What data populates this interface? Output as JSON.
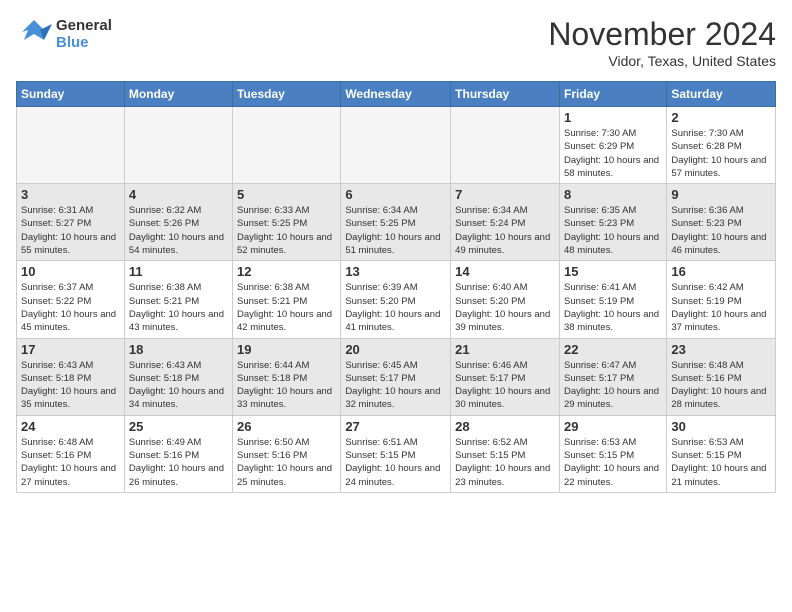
{
  "logo": {
    "text_general": "General",
    "text_blue": "Blue"
  },
  "title": "November 2024",
  "location": "Vidor, Texas, United States",
  "weekdays": [
    "Sunday",
    "Monday",
    "Tuesday",
    "Wednesday",
    "Thursday",
    "Friday",
    "Saturday"
  ],
  "weeks": [
    [
      {
        "day": "",
        "empty": true
      },
      {
        "day": "",
        "empty": true
      },
      {
        "day": "",
        "empty": true
      },
      {
        "day": "",
        "empty": true
      },
      {
        "day": "",
        "empty": true
      },
      {
        "day": "1",
        "sunrise": "Sunrise: 7:30 AM",
        "sunset": "Sunset: 6:29 PM",
        "daylight": "Daylight: 10 hours and 58 minutes."
      },
      {
        "day": "2",
        "sunrise": "Sunrise: 7:30 AM",
        "sunset": "Sunset: 6:28 PM",
        "daylight": "Daylight: 10 hours and 57 minutes."
      }
    ],
    [
      {
        "day": "3",
        "sunrise": "Sunrise: 6:31 AM",
        "sunset": "Sunset: 5:27 PM",
        "daylight": "Daylight: 10 hours and 55 minutes."
      },
      {
        "day": "4",
        "sunrise": "Sunrise: 6:32 AM",
        "sunset": "Sunset: 5:26 PM",
        "daylight": "Daylight: 10 hours and 54 minutes."
      },
      {
        "day": "5",
        "sunrise": "Sunrise: 6:33 AM",
        "sunset": "Sunset: 5:25 PM",
        "daylight": "Daylight: 10 hours and 52 minutes."
      },
      {
        "day": "6",
        "sunrise": "Sunrise: 6:34 AM",
        "sunset": "Sunset: 5:25 PM",
        "daylight": "Daylight: 10 hours and 51 minutes."
      },
      {
        "day": "7",
        "sunrise": "Sunrise: 6:34 AM",
        "sunset": "Sunset: 5:24 PM",
        "daylight": "Daylight: 10 hours and 49 minutes."
      },
      {
        "day": "8",
        "sunrise": "Sunrise: 6:35 AM",
        "sunset": "Sunset: 5:23 PM",
        "daylight": "Daylight: 10 hours and 48 minutes."
      },
      {
        "day": "9",
        "sunrise": "Sunrise: 6:36 AM",
        "sunset": "Sunset: 5:23 PM",
        "daylight": "Daylight: 10 hours and 46 minutes."
      }
    ],
    [
      {
        "day": "10",
        "sunrise": "Sunrise: 6:37 AM",
        "sunset": "Sunset: 5:22 PM",
        "daylight": "Daylight: 10 hours and 45 minutes."
      },
      {
        "day": "11",
        "sunrise": "Sunrise: 6:38 AM",
        "sunset": "Sunset: 5:21 PM",
        "daylight": "Daylight: 10 hours and 43 minutes."
      },
      {
        "day": "12",
        "sunrise": "Sunrise: 6:38 AM",
        "sunset": "Sunset: 5:21 PM",
        "daylight": "Daylight: 10 hours and 42 minutes."
      },
      {
        "day": "13",
        "sunrise": "Sunrise: 6:39 AM",
        "sunset": "Sunset: 5:20 PM",
        "daylight": "Daylight: 10 hours and 41 minutes."
      },
      {
        "day": "14",
        "sunrise": "Sunrise: 6:40 AM",
        "sunset": "Sunset: 5:20 PM",
        "daylight": "Daylight: 10 hours and 39 minutes."
      },
      {
        "day": "15",
        "sunrise": "Sunrise: 6:41 AM",
        "sunset": "Sunset: 5:19 PM",
        "daylight": "Daylight: 10 hours and 38 minutes."
      },
      {
        "day": "16",
        "sunrise": "Sunrise: 6:42 AM",
        "sunset": "Sunset: 5:19 PM",
        "daylight": "Daylight: 10 hours and 37 minutes."
      }
    ],
    [
      {
        "day": "17",
        "sunrise": "Sunrise: 6:43 AM",
        "sunset": "Sunset: 5:18 PM",
        "daylight": "Daylight: 10 hours and 35 minutes."
      },
      {
        "day": "18",
        "sunrise": "Sunrise: 6:43 AM",
        "sunset": "Sunset: 5:18 PM",
        "daylight": "Daylight: 10 hours and 34 minutes."
      },
      {
        "day": "19",
        "sunrise": "Sunrise: 6:44 AM",
        "sunset": "Sunset: 5:18 PM",
        "daylight": "Daylight: 10 hours and 33 minutes."
      },
      {
        "day": "20",
        "sunrise": "Sunrise: 6:45 AM",
        "sunset": "Sunset: 5:17 PM",
        "daylight": "Daylight: 10 hours and 32 minutes."
      },
      {
        "day": "21",
        "sunrise": "Sunrise: 6:46 AM",
        "sunset": "Sunset: 5:17 PM",
        "daylight": "Daylight: 10 hours and 30 minutes."
      },
      {
        "day": "22",
        "sunrise": "Sunrise: 6:47 AM",
        "sunset": "Sunset: 5:17 PM",
        "daylight": "Daylight: 10 hours and 29 minutes."
      },
      {
        "day": "23",
        "sunrise": "Sunrise: 6:48 AM",
        "sunset": "Sunset: 5:16 PM",
        "daylight": "Daylight: 10 hours and 28 minutes."
      }
    ],
    [
      {
        "day": "24",
        "sunrise": "Sunrise: 6:48 AM",
        "sunset": "Sunset: 5:16 PM",
        "daylight": "Daylight: 10 hours and 27 minutes."
      },
      {
        "day": "25",
        "sunrise": "Sunrise: 6:49 AM",
        "sunset": "Sunset: 5:16 PM",
        "daylight": "Daylight: 10 hours and 26 minutes."
      },
      {
        "day": "26",
        "sunrise": "Sunrise: 6:50 AM",
        "sunset": "Sunset: 5:16 PM",
        "daylight": "Daylight: 10 hours and 25 minutes."
      },
      {
        "day": "27",
        "sunrise": "Sunrise: 6:51 AM",
        "sunset": "Sunset: 5:15 PM",
        "daylight": "Daylight: 10 hours and 24 minutes."
      },
      {
        "day": "28",
        "sunrise": "Sunrise: 6:52 AM",
        "sunset": "Sunset: 5:15 PM",
        "daylight": "Daylight: 10 hours and 23 minutes."
      },
      {
        "day": "29",
        "sunrise": "Sunrise: 6:53 AM",
        "sunset": "Sunset: 5:15 PM",
        "daylight": "Daylight: 10 hours and 22 minutes."
      },
      {
        "day": "30",
        "sunrise": "Sunrise: 6:53 AM",
        "sunset": "Sunset: 5:15 PM",
        "daylight": "Daylight: 10 hours and 21 minutes."
      }
    ]
  ]
}
